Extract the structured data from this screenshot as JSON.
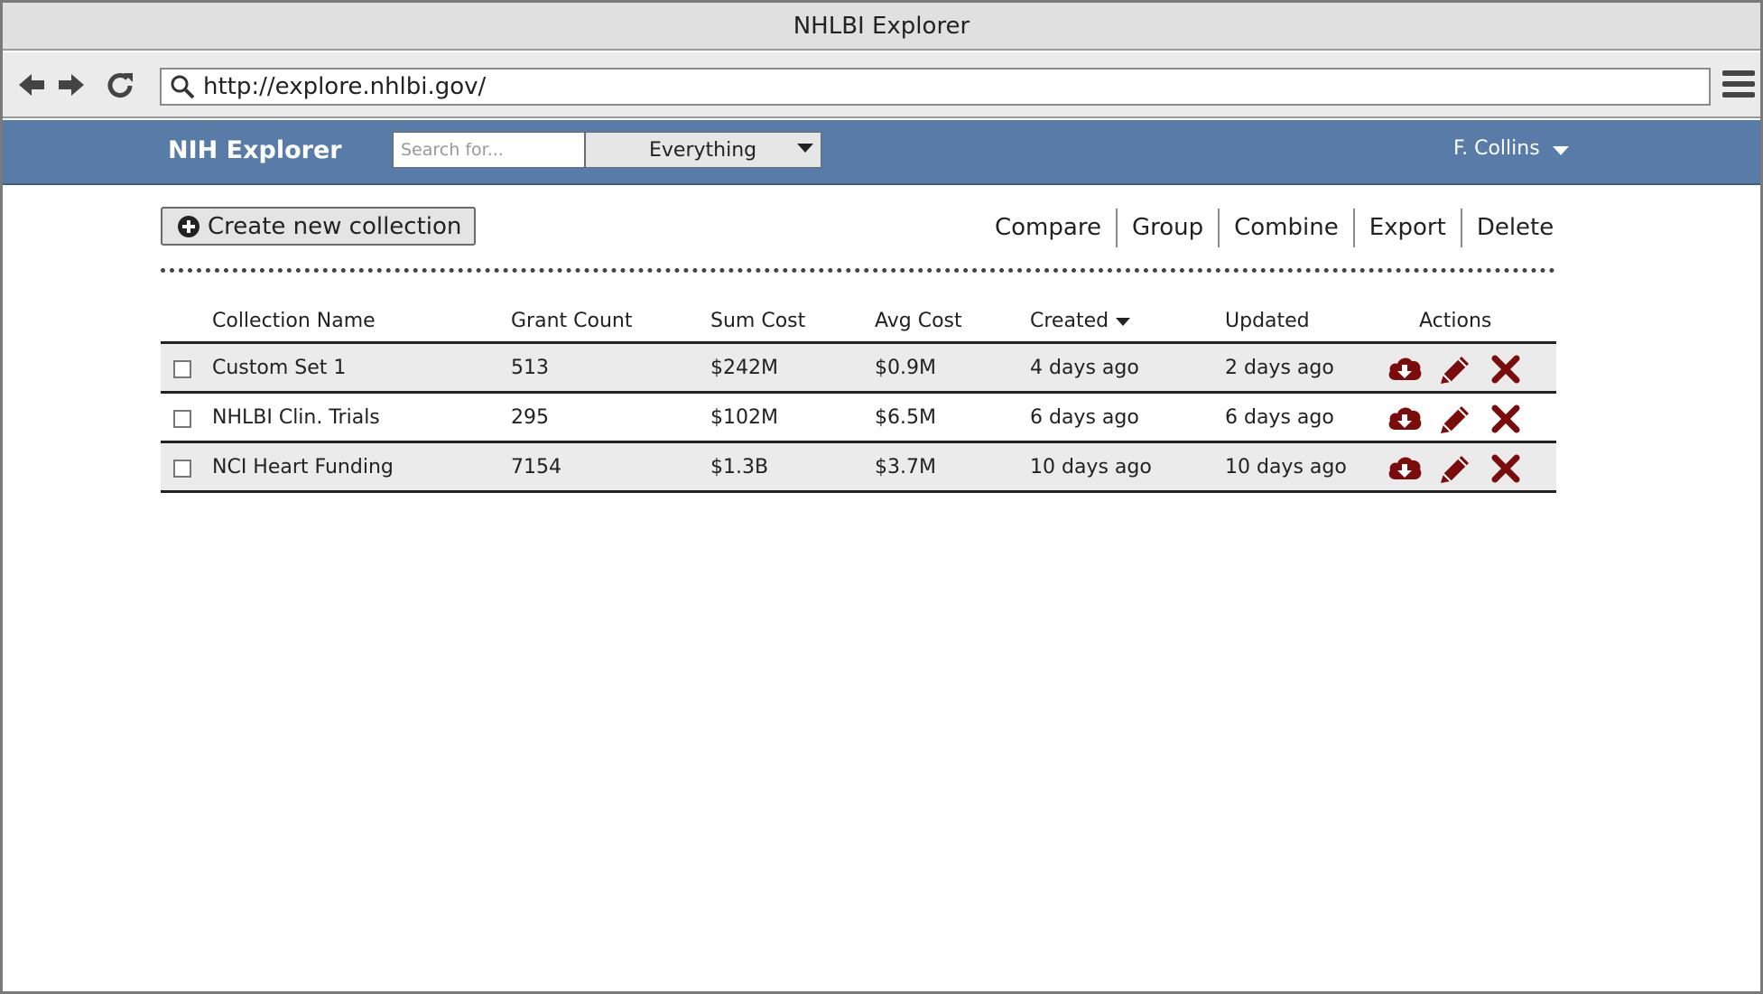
{
  "window": {
    "title": "NHLBI Explorer"
  },
  "browser": {
    "url": "http://explore.nhlbi.gov/"
  },
  "app": {
    "brand": "NIH Explorer",
    "search": {
      "placeholder": "Search for...",
      "value": ""
    },
    "scope": "Everything",
    "user": "F. Collins"
  },
  "toolbar": {
    "create_label": "Create new collection",
    "actions": [
      "Compare",
      "Group",
      "Combine",
      "Export",
      "Delete"
    ]
  },
  "table": {
    "columns": [
      "Collection Name",
      "Grant Count",
      "Sum Cost",
      "Avg Cost",
      "Created",
      "Updated",
      "Actions"
    ],
    "sorted_by": "Created",
    "rows": [
      {
        "name": "Custom Set 1",
        "grants": "513",
        "sum": "$242M",
        "avg": "$0.9M",
        "created": "4 days ago",
        "updated": "2 days ago"
      },
      {
        "name": "NHLBI Clin. Trials",
        "grants": "295",
        "sum": "$102M",
        "avg": "$6.5M",
        "created": "6 days ago",
        "updated": "6 days ago"
      },
      {
        "name": "NCI Heart Funding",
        "grants": "7154",
        "sum": "$1.3B",
        "avg": "$3.7M",
        "created": "10 days ago",
        "updated": "10 days ago"
      }
    ]
  },
  "colors": {
    "appbar": "#587ba8",
    "action_icon": "#7a0c0c"
  },
  "icons": {
    "download": "cloud-download-icon",
    "edit": "pencil-icon",
    "delete": "x-icon"
  }
}
